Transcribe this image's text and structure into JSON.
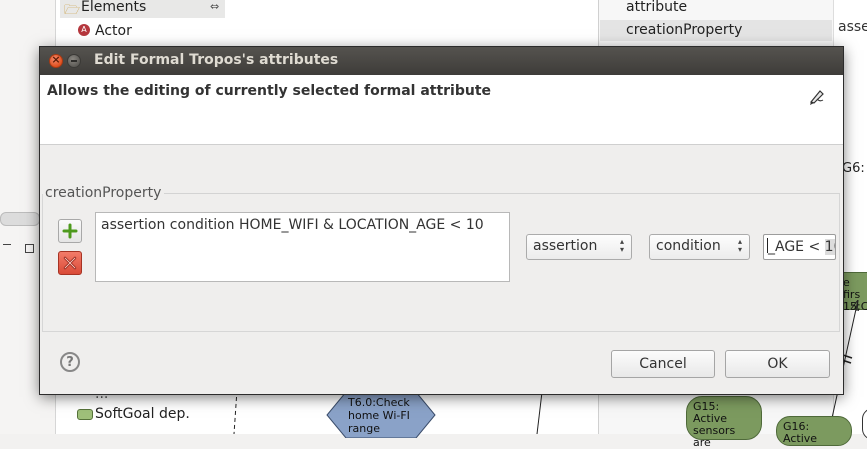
{
  "background": {
    "tree": {
      "elements_label": "Elements",
      "actor_label": "Actor",
      "softgoal_dep_label": "SoftGoal dep.",
      "partial_above_label": "..."
    },
    "properties": {
      "rows": [
        "attribute",
        "creationProperty"
      ],
      "value_fragment": "asse",
      "side_fragment": "G6:"
    },
    "diagram": {
      "task_node": "T6.0:Check home Wi-FI range",
      "goal_g15": "G15: Active sensors are",
      "goal_g16": "G16: Active",
      "top_fragment_1": "e firs",
      "top_fragment_2": "15;C"
    }
  },
  "dialog": {
    "title": "Edit Formal Tropos's attributes",
    "description": "Allows the editing of currently selected formal attribute",
    "group_label": "creationProperty",
    "property_text": "assertion condition HOME_WIFI & LOCATION_AGE < 10",
    "kind_select": {
      "selected": "assertion"
    },
    "type_select": {
      "selected": "condition"
    },
    "expression_field": {
      "visible_text": "_AGE < ",
      "highlighted_text": "10"
    },
    "help_label": "?",
    "cancel_label": "Cancel",
    "ok_label": "OK"
  },
  "colors": {
    "titlebar": "#3e3c39",
    "close_button": "#e0501f",
    "delete_button": "#d94a37",
    "add_icon": "#4d9a1d",
    "goal_node": "#7c9a5f",
    "task_node": "#8aa2c8"
  }
}
